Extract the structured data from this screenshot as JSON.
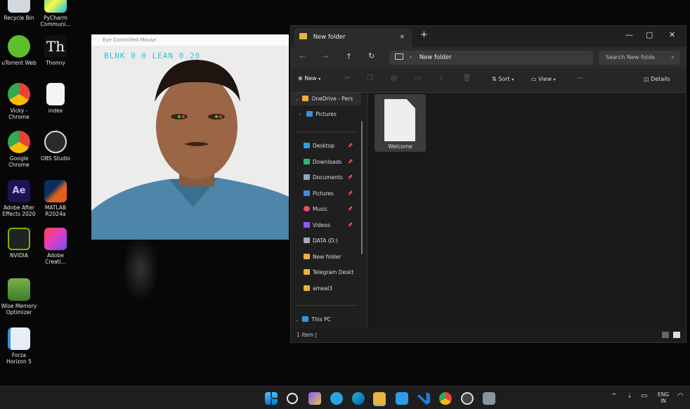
{
  "desktop": {
    "icons": [
      {
        "label": "Recycle Bin",
        "icon": "recycle-bin-icon"
      },
      {
        "label": "PyCharm\nCommuni...",
        "icon": "pycharm-icon"
      },
      {
        "label": "uTorrent Web",
        "icon": "utorrent-icon"
      },
      {
        "label": "Thonny",
        "icon": "thonny-icon"
      },
      {
        "label": "Vicky -\nChrome",
        "icon": "chrome-icon"
      },
      {
        "label": "index",
        "icon": "chrome-file-icon"
      },
      {
        "label": "Google\nChrome",
        "icon": "chrome-icon"
      },
      {
        "label": "OBS Studio",
        "icon": "obs-icon"
      },
      {
        "label": "Adobe After\nEffects 2020",
        "icon": "after-effects-icon"
      },
      {
        "label": "MATLAB\nR2024a",
        "icon": "matlab-icon"
      },
      {
        "label": "NVIDIA",
        "icon": "nvidia-icon"
      },
      {
        "label": "Adobe\nCreati...",
        "icon": "creative-cloud-icon"
      },
      {
        "label": "Wise Memory\nOptimizer",
        "icon": "wise-memory-icon"
      },
      {
        "label": "Forza\nHorizon 5",
        "icon": "forza-icon"
      }
    ]
  },
  "camera_window": {
    "title": "Eye Controlled Mouse",
    "overlay": "BLNK 0 0 LEAN 0.20"
  },
  "explorer": {
    "tab_title": "New folder",
    "close_tab": "✕",
    "new_tab": "+",
    "window_controls": {
      "minimize": "—",
      "maximize": "▢",
      "close": "✕"
    },
    "address_path": "New folder",
    "search_placeholder": "Search New folde",
    "toolbar": {
      "new": "New",
      "sort": "Sort",
      "view": "View",
      "more": "···",
      "details": "Details"
    },
    "nav": {
      "onedrive": "OneDrive - Pers",
      "pictures_top": "Pictures",
      "quick": [
        {
          "label": "Desktop",
          "color": "#2f9be6"
        },
        {
          "label": "Downloads",
          "color": "#39b36a"
        },
        {
          "label": "Documents",
          "color": "#8aa6c7"
        },
        {
          "label": "Pictures",
          "color": "#3a8fd9"
        },
        {
          "label": "Music",
          "color": "#e2525c"
        },
        {
          "label": "Videos",
          "color": "#8b5cf6"
        },
        {
          "label": "DATA (D:)",
          "color": "#aaaaaa"
        },
        {
          "label": "New folder",
          "color": "#e8b43a"
        },
        {
          "label": "Telegram Deskt",
          "color": "#e8b43a"
        },
        {
          "label": "ameal3",
          "color": "#e8b43a"
        }
      ],
      "this_pc": "This PC"
    },
    "file": {
      "name": "Welcome"
    },
    "status": "1 item  |"
  },
  "taskbar": {
    "lang_line1": "ENG",
    "lang_line2": "IN"
  },
  "colors": {
    "accent": "#2f9be6",
    "folder": "#e8b43a"
  }
}
